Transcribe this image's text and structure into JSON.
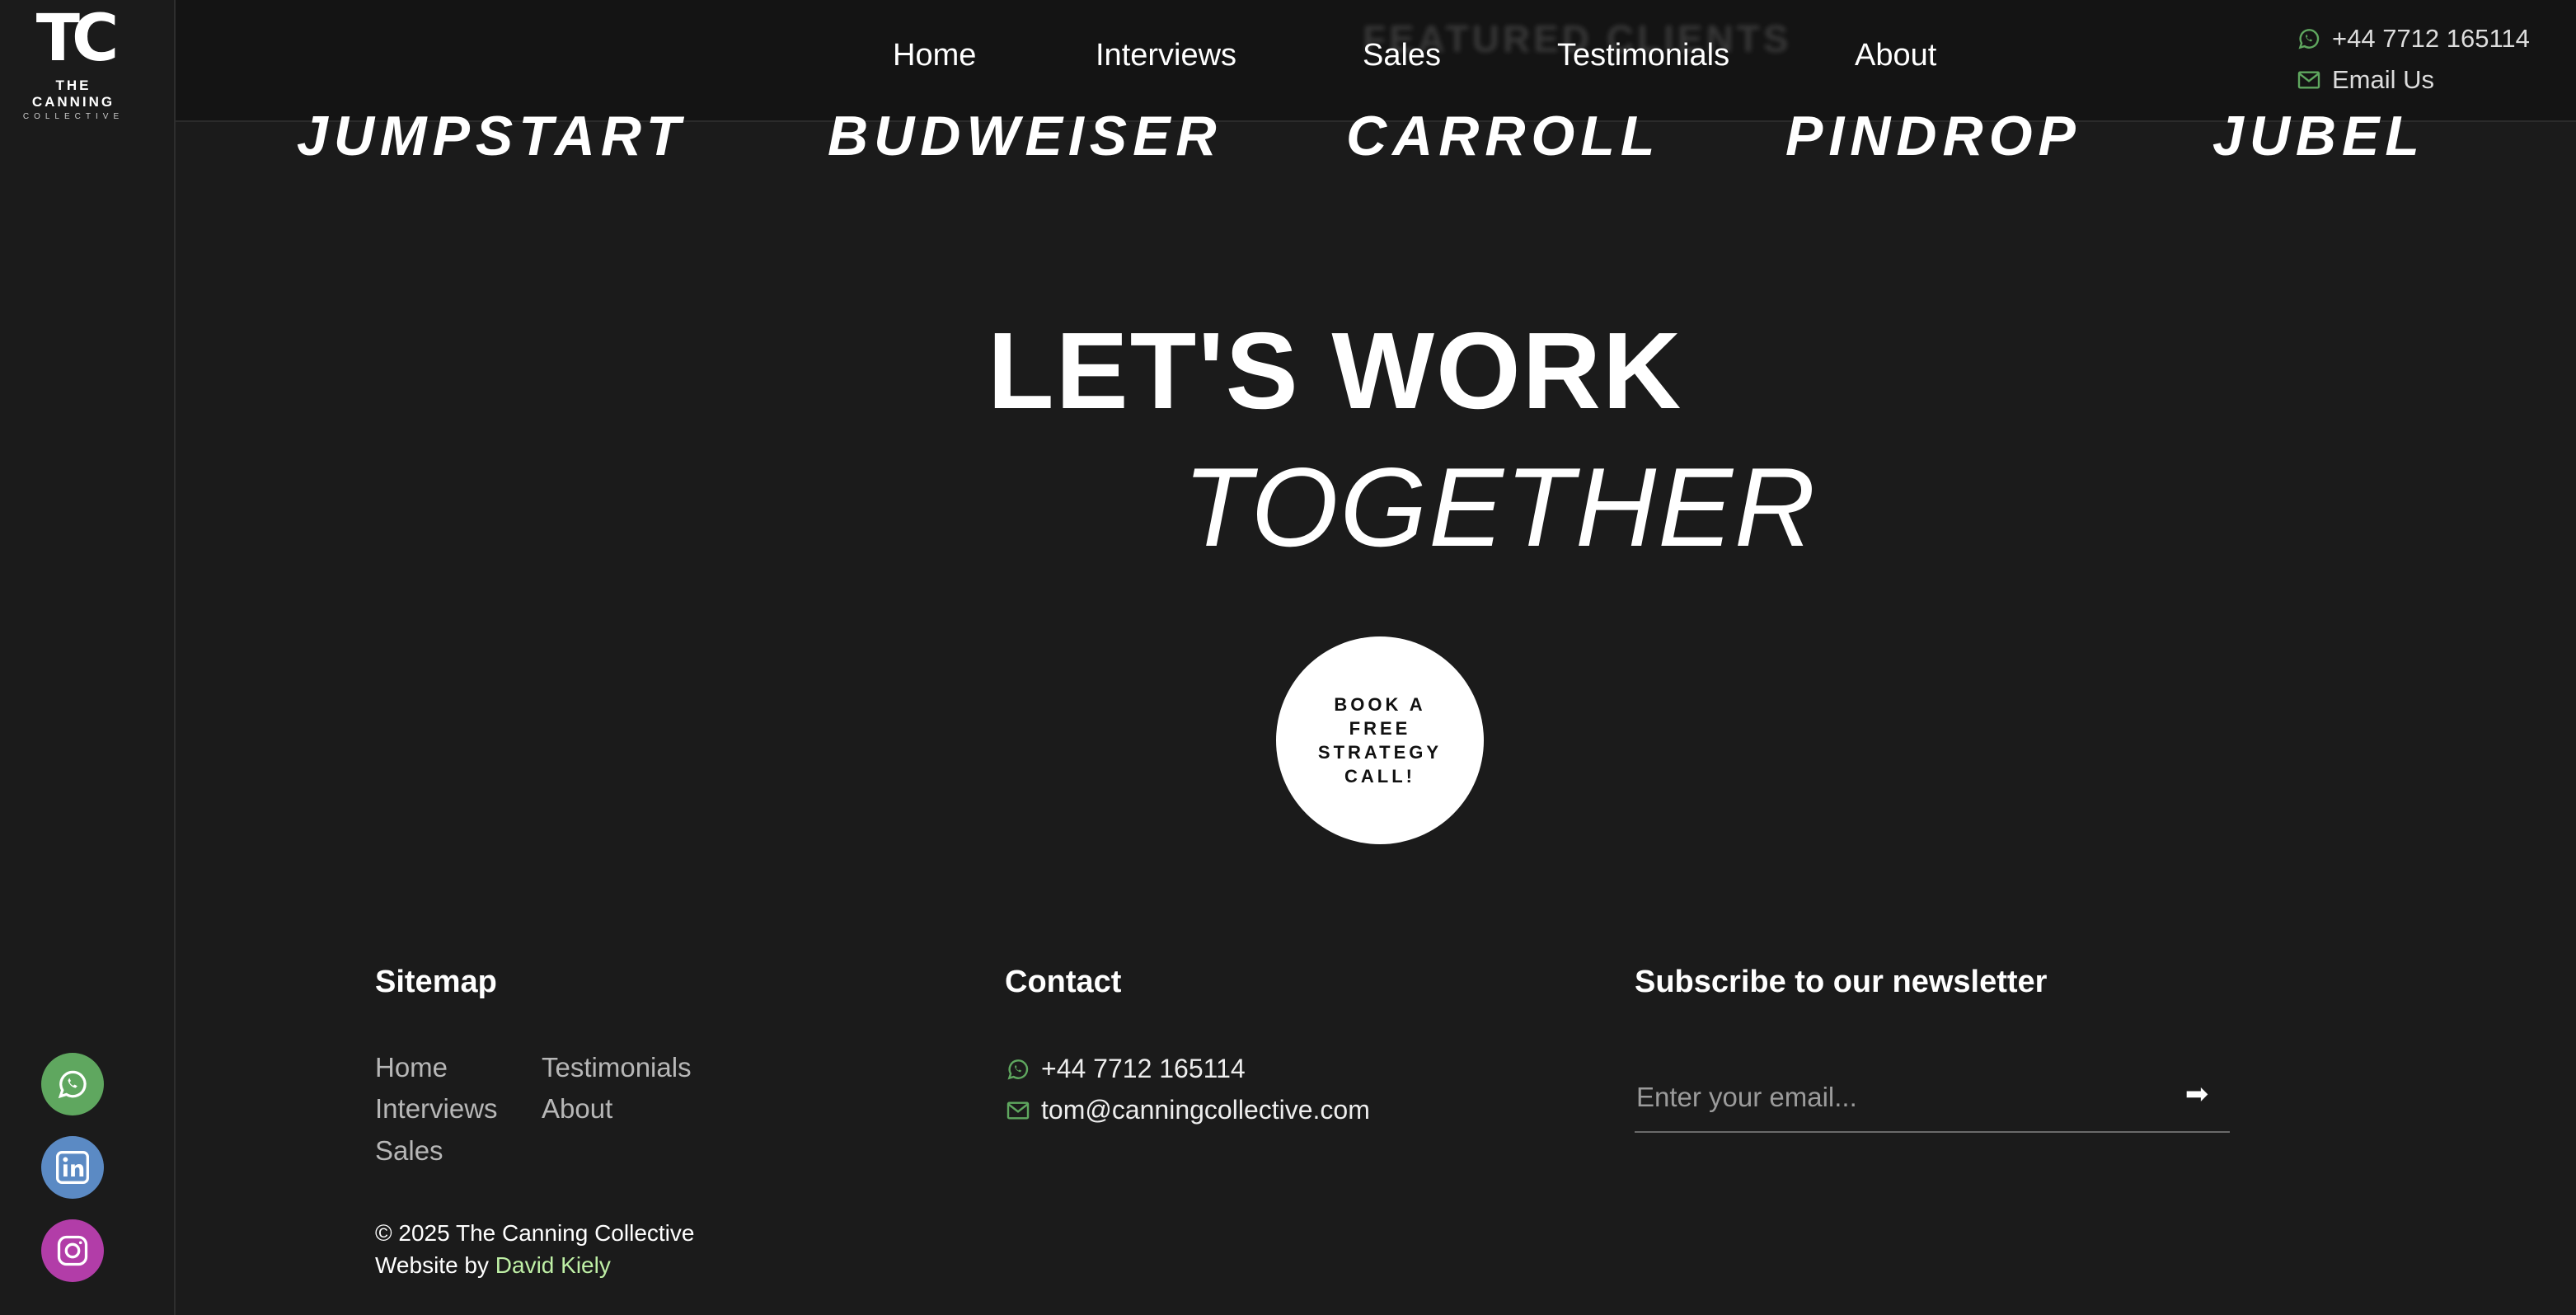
{
  "brand": {
    "logo_mark": "TC",
    "logo_name": "THE CANNING",
    "logo_sub": "COLLECTIVE"
  },
  "header": {
    "ghost_title": "FEATURED CLIENTS",
    "nav": [
      "Home",
      "Interviews",
      "Sales",
      "Testimonials",
      "About"
    ],
    "phone": "+44 7712 165114",
    "email_label": "Email Us"
  },
  "clients": [
    "JUMPSTART",
    "BUDWEISER",
    "CARROLL",
    "PINDROP",
    "JUBEL"
  ],
  "cta": {
    "line1": "LET'S WORK",
    "line2": "TOGETHER",
    "button": "BOOK A FREE STRATEGY CALL!"
  },
  "footer": {
    "sitemap_title": "Sitemap",
    "sitemap_links": [
      "Home",
      "Testimonials",
      "Interviews",
      "About",
      "Sales"
    ],
    "contact_title": "Contact",
    "contact_phone": "+44 7712 165114",
    "contact_email": "tom@canningcollective.com",
    "newsletter_title": "Subscribe to our newsletter",
    "newsletter_placeholder": "Enter your email...",
    "submit_symbol": "➡",
    "copyright": "© 2025 The Canning Collective",
    "credit_prefix": "Website by",
    "credit_name": "David Kiely"
  },
  "colors": {
    "background": "#1b1b1b",
    "header": "#141414",
    "whatsapp": "#5fa75f",
    "linkedin": "#5b8ac4",
    "instagram": "#b23da8",
    "credit_link": "#bff0a6"
  },
  "icons": [
    "whatsapp-icon",
    "mail-icon",
    "linkedin-icon",
    "instagram-icon"
  ]
}
